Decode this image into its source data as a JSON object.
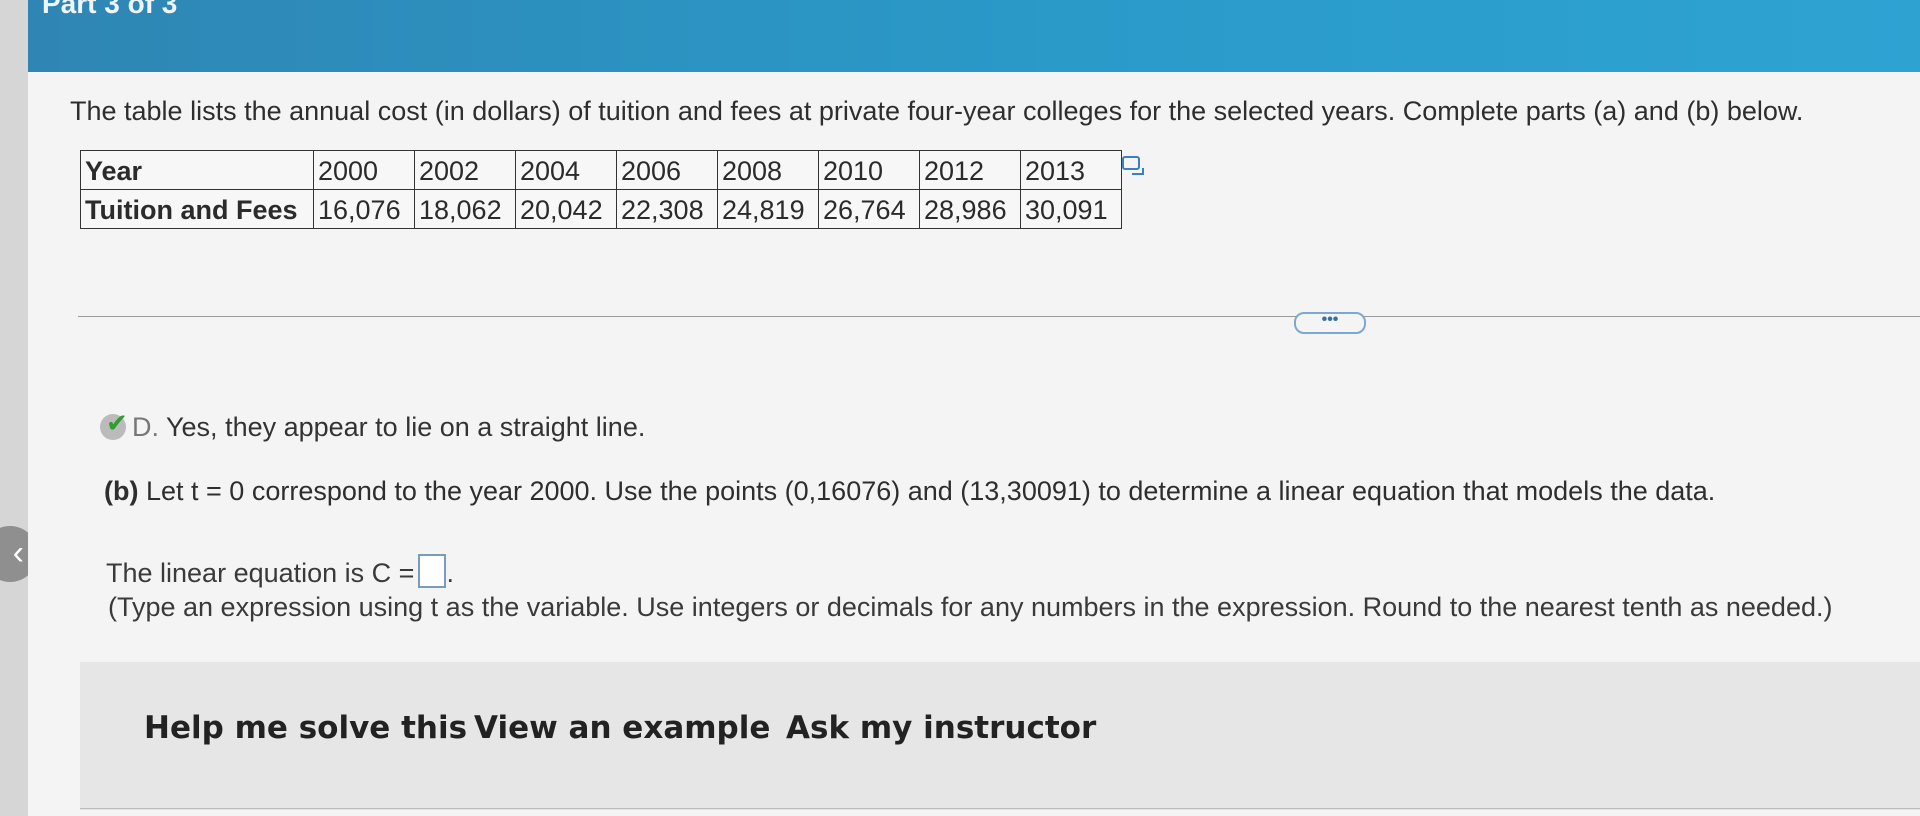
{
  "header": {
    "part_label": "Part 3 of 3"
  },
  "question": {
    "prompt": "The table lists the annual cost (in dollars) of tuition and fees at private four-year colleges for the selected years. Complete parts (a) and (b) below."
  },
  "table": {
    "row_labels": [
      "Year",
      "Tuition and Fees"
    ],
    "years": [
      "2000",
      "2002",
      "2004",
      "2006",
      "2008",
      "2010",
      "2012",
      "2013"
    ],
    "costs": [
      "16,076",
      "18,062",
      "20,042",
      "22,308",
      "24,819",
      "26,764",
      "28,986",
      "30,091"
    ]
  },
  "more_button": "•••",
  "part_a": {
    "letter": "D.",
    "answer": "Yes, they appear to lie on a straight line."
  },
  "part_b": {
    "label": "(b)",
    "text": "Let t = 0 correspond to the year 2000. Use the points (0,16076) and (13,30091) to determine a linear equation that models the data.",
    "equation_prefix": "The linear equation is C =",
    "equation_value": "",
    "hint": "(Type an expression using t as the variable. Use integers or decimals for any numbers in the expression. Round to the nearest tenth as needed.)"
  },
  "actions": {
    "help": "Help me solve this",
    "example": "View an example",
    "instructor": "Ask my instructor"
  }
}
